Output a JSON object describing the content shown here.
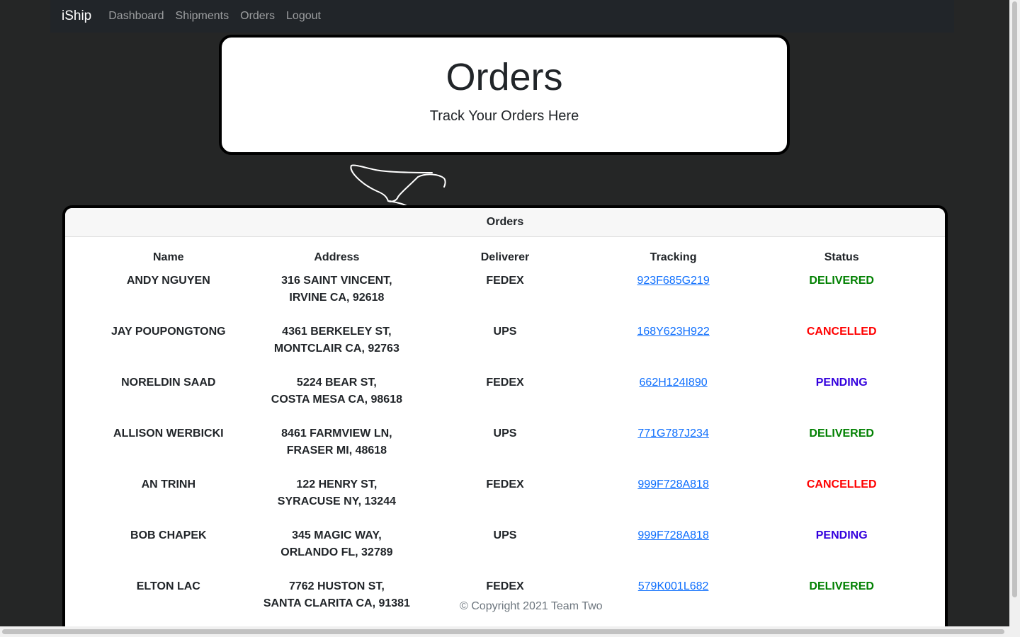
{
  "navbar": {
    "brand": "iShip",
    "links": [
      "Dashboard",
      "Shipments",
      "Orders",
      "Logout"
    ]
  },
  "hero": {
    "title": "Orders",
    "subtitle": "Track Your Orders Here"
  },
  "orders_card": {
    "title": "Orders",
    "columns": [
      "Name",
      "Address",
      "Deliverer",
      "Tracking",
      "Status"
    ],
    "rows": [
      {
        "name": "ANDY NGUYEN",
        "address_line1": "316 SAINT VINCENT,",
        "address_line2": "IRVINE CA, 92618",
        "deliverer": "FEDEX",
        "tracking": "923F685G219",
        "status": "DELIVERED"
      },
      {
        "name": "JAY POUPONGTONG",
        "address_line1": "4361 BERKELEY ST,",
        "address_line2": "MONTCLAIR CA, 92763",
        "deliverer": "UPS",
        "tracking": "168Y623H922",
        "status": "CANCELLED"
      },
      {
        "name": "NORELDIN SAAD",
        "address_line1": "5224 BEAR ST,",
        "address_line2": "COSTA MESA CA, 98618",
        "deliverer": "FEDEX",
        "tracking": "662H124I890",
        "status": "PENDING"
      },
      {
        "name": "ALLISON WERBICKI",
        "address_line1": "8461 FARMVIEW LN,",
        "address_line2": "FRASER MI, 48618",
        "deliverer": "UPS",
        "tracking": "771G787J234",
        "status": "DELIVERED"
      },
      {
        "name": "AN TRINH",
        "address_line1": "122 HENRY ST,",
        "address_line2": "SYRACUSE NY, 13244",
        "deliverer": "FEDEX",
        "tracking": "999F728A818",
        "status": "CANCELLED"
      },
      {
        "name": "BOB CHAPEK",
        "address_line1": "345 MAGIC WAY,",
        "address_line2": "ORLANDO FL, 32789",
        "deliverer": "UPS",
        "tracking": "999F728A818",
        "status": "PENDING"
      },
      {
        "name": "ELTON LAC",
        "address_line1": "7762 HUSTON ST,",
        "address_line2": "SANTA CLARITA CA, 91381",
        "deliverer": "FEDEX",
        "tracking": "579K001L682",
        "status": "DELIVERED"
      }
    ]
  },
  "status_colors": {
    "DELIVERED": "#008000",
    "CANCELLED": "#ff0000",
    "PENDING": "#3300dd"
  },
  "footer": {
    "text": "© Copyright 2021 Team Two"
  }
}
